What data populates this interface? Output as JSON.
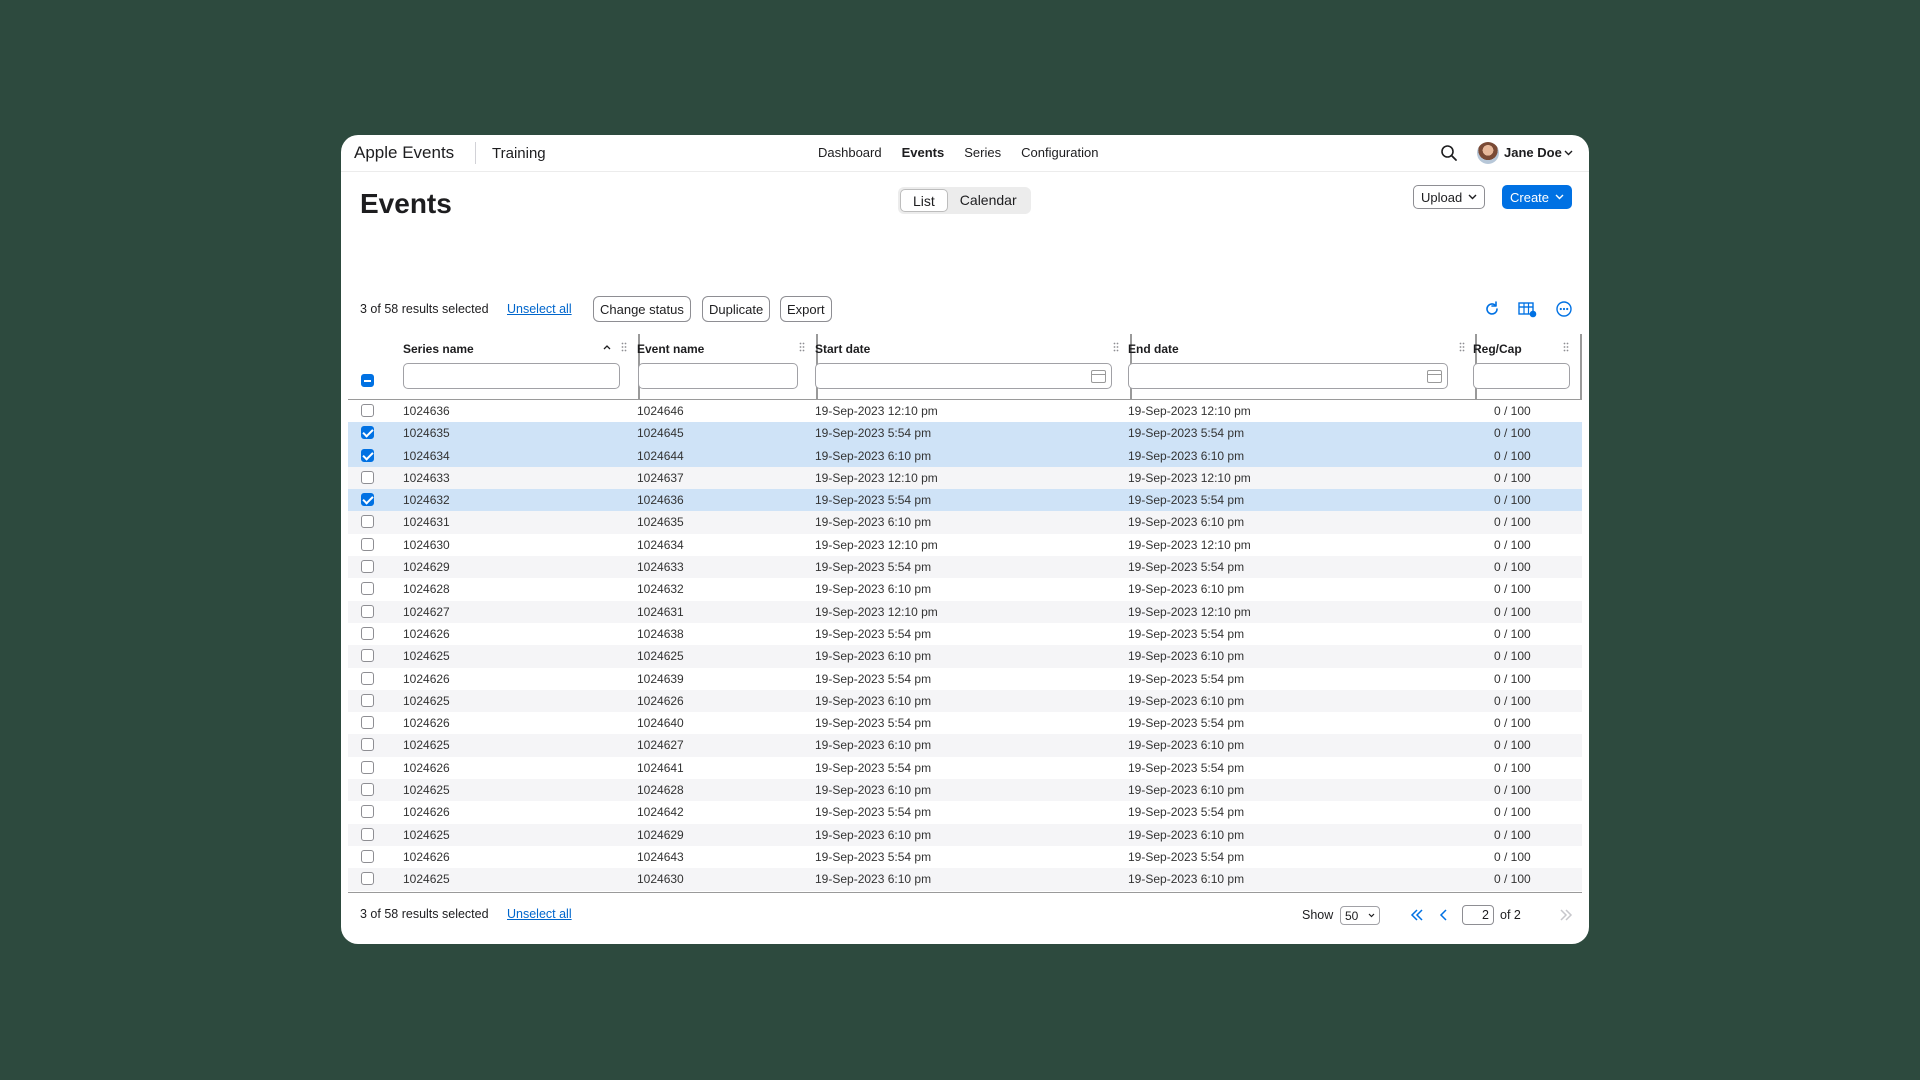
{
  "app": {
    "brand": "Apple Events",
    "subtitle": "Training"
  },
  "nav": {
    "items": [
      "Dashboard",
      "Events",
      "Series",
      "Configuration"
    ],
    "active": "Events"
  },
  "user": {
    "name": "Jane Doe"
  },
  "page": {
    "title": "Events"
  },
  "view_toggle": {
    "list": "List",
    "calendar": "Calendar",
    "active": "List"
  },
  "actions": {
    "upload": "Upload",
    "create": "Create"
  },
  "toolbar": {
    "selection": "3 of 58 results selected",
    "unselect": "Unselect all",
    "change_status": "Change status",
    "duplicate": "Duplicate",
    "export": "Export"
  },
  "columns": {
    "series": "Series name",
    "event": "Event name",
    "start": "Start date",
    "end": "End date",
    "reg": "Reg/Cap"
  },
  "rows": [
    {
      "series": "1024636",
      "event": "1024646",
      "start": "19-Sep-2023 12:10 pm",
      "end": "19-Sep-2023 12:10 pm",
      "reg": "0 / 100",
      "selected": false
    },
    {
      "series": "1024635",
      "event": "1024645",
      "start": "19-Sep-2023 5:54 pm",
      "end": "19-Sep-2023 5:54 pm",
      "reg": "0 / 100",
      "selected": true
    },
    {
      "series": "1024634",
      "event": "1024644",
      "start": "19-Sep-2023 6:10 pm",
      "end": "19-Sep-2023 6:10 pm",
      "reg": "0 / 100",
      "selected": true
    },
    {
      "series": "1024633",
      "event": "1024637",
      "start": "19-Sep-2023 12:10 pm",
      "end": "19-Sep-2023 12:10 pm",
      "reg": "0 / 100",
      "selected": false
    },
    {
      "series": "1024632",
      "event": "1024636",
      "start": "19-Sep-2023 5:54 pm",
      "end": "19-Sep-2023 5:54 pm",
      "reg": "0 / 100",
      "selected": true
    },
    {
      "series": "1024631",
      "event": "1024635",
      "start": "19-Sep-2023 6:10 pm",
      "end": "19-Sep-2023 6:10 pm",
      "reg": "0 / 100",
      "selected": false
    },
    {
      "series": "1024630",
      "event": "1024634",
      "start": "19-Sep-2023 12:10 pm",
      "end": "19-Sep-2023 12:10 pm",
      "reg": "0 / 100",
      "selected": false
    },
    {
      "series": "1024629",
      "event": "1024633",
      "start": "19-Sep-2023 5:54 pm",
      "end": "19-Sep-2023 5:54 pm",
      "reg": "0 / 100",
      "selected": false
    },
    {
      "series": "1024628",
      "event": "1024632",
      "start": "19-Sep-2023 6:10 pm",
      "end": "19-Sep-2023 6:10 pm",
      "reg": "0 / 100",
      "selected": false
    },
    {
      "series": "1024627",
      "event": "1024631",
      "start": "19-Sep-2023 12:10 pm",
      "end": "19-Sep-2023 12:10 pm",
      "reg": "0 / 100",
      "selected": false
    },
    {
      "series": "1024626",
      "event": "1024638",
      "start": "19-Sep-2023 5:54 pm",
      "end": "19-Sep-2023 5:54 pm",
      "reg": "0 / 100",
      "selected": false
    },
    {
      "series": "1024625",
      "event": "1024625",
      "start": "19-Sep-2023 6:10 pm",
      "end": "19-Sep-2023 6:10 pm",
      "reg": "0 / 100",
      "selected": false
    },
    {
      "series": "1024626",
      "event": "1024639",
      "start": "19-Sep-2023 5:54 pm",
      "end": "19-Sep-2023 5:54 pm",
      "reg": "0 / 100",
      "selected": false
    },
    {
      "series": "1024625",
      "event": "1024626",
      "start": "19-Sep-2023 6:10 pm",
      "end": "19-Sep-2023 6:10 pm",
      "reg": "0 / 100",
      "selected": false
    },
    {
      "series": "1024626",
      "event": "1024640",
      "start": "19-Sep-2023 5:54 pm",
      "end": "19-Sep-2023 5:54 pm",
      "reg": "0 / 100",
      "selected": false
    },
    {
      "series": "1024625",
      "event": "1024627",
      "start": "19-Sep-2023 6:10 pm",
      "end": "19-Sep-2023 6:10 pm",
      "reg": "0 / 100",
      "selected": false
    },
    {
      "series": "1024626",
      "event": "1024641",
      "start": "19-Sep-2023 5:54 pm",
      "end": "19-Sep-2023 5:54 pm",
      "reg": "0 / 100",
      "selected": false
    },
    {
      "series": "1024625",
      "event": "1024628",
      "start": "19-Sep-2023 6:10 pm",
      "end": "19-Sep-2023 6:10 pm",
      "reg": "0 / 100",
      "selected": false
    },
    {
      "series": "1024626",
      "event": "1024642",
      "start": "19-Sep-2023 5:54 pm",
      "end": "19-Sep-2023 5:54 pm",
      "reg": "0 / 100",
      "selected": false
    },
    {
      "series": "1024625",
      "event": "1024629",
      "start": "19-Sep-2023 6:10 pm",
      "end": "19-Sep-2023 6:10 pm",
      "reg": "0 / 100",
      "selected": false
    },
    {
      "series": "1024626",
      "event": "1024643",
      "start": "19-Sep-2023 5:54 pm",
      "end": "19-Sep-2023 5:54 pm",
      "reg": "0 / 100",
      "selected": false
    },
    {
      "series": "1024625",
      "event": "1024630",
      "start": "19-Sep-2023 6:10 pm",
      "end": "19-Sep-2023 6:10 pm",
      "reg": "0 / 100",
      "selected": false
    }
  ],
  "footer": {
    "selection": "3 of 58 results selected",
    "unselect": "Unselect all",
    "show_label": "Show",
    "page_size": "50",
    "page": "2",
    "of_pages": "of 2"
  },
  "colors": {
    "accent": "#0071e3",
    "selected_row": "#cfe3f7",
    "background": "#2d4a3e"
  },
  "icons": [
    "search-icon",
    "chevron-down-icon",
    "refresh-icon",
    "table-settings-icon",
    "more-icon",
    "grip-icon",
    "calendar-icon",
    "sort-asc-icon",
    "first-page-icon",
    "prev-page-icon",
    "last-page-icon"
  ]
}
